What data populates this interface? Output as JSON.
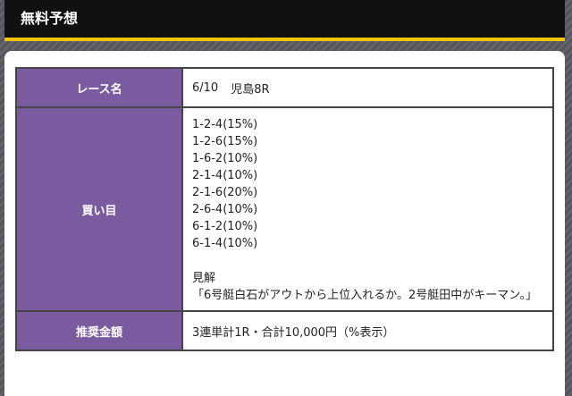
{
  "header": {
    "title": "無料予想",
    "accent_color": "#f2c500",
    "background_color": "#111111"
  },
  "table": {
    "label_color": "#7b5ba0",
    "race": {
      "label": "レース名",
      "date": "6/10",
      "venue": "児島8R"
    },
    "bets": {
      "label": "買い目",
      "items": [
        "1-2-4(15%)",
        "1-2-6(15%)",
        "1-6-2(10%)",
        "2-1-4(10%)",
        "2-1-6(20%)",
        "2-6-4(10%)",
        "6-1-2(10%)",
        "6-1-4(10%)"
      ],
      "opinion_title": "見解",
      "opinion_text": "「6号艇白石がアウトから上位入れるか。2号艇田中がキーマン。」"
    },
    "amount": {
      "label": "推奨金額",
      "value": "3連単計1R・合計10,000円（%表示）"
    }
  }
}
